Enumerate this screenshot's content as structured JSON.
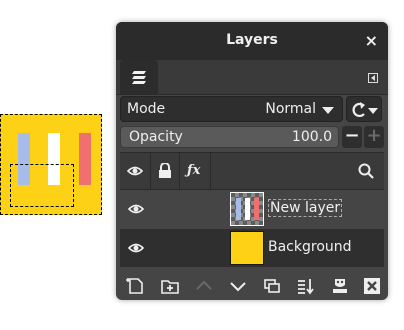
{
  "panel": {
    "title": "Layers",
    "close_glyph": "×"
  },
  "mode": {
    "label": "Mode",
    "value": "Normal"
  },
  "opacity": {
    "label": "Opacity",
    "value": "100.0",
    "decrease_glyph": "−",
    "increase_glyph": "+"
  },
  "layers": [
    {
      "name": "New layer",
      "selected": false,
      "visible": true
    },
    {
      "name": "Background",
      "selected": true,
      "visible": true
    }
  ],
  "icons": {
    "tab": "layers-tab-icon",
    "header_eye": "eye-icon",
    "header_lock": "lock-icon",
    "header_fx": "fx-icon",
    "header_search": "search-icon",
    "bottom": [
      "new-layer-icon",
      "new-group-icon",
      "raise-layer-icon",
      "lower-layer-icon",
      "duplicate-layer-icon",
      "merge-down-icon",
      "add-mask-icon",
      "delete-layer-icon"
    ]
  },
  "colors": {
    "canvas_yellow": "#fcd116",
    "stripe_blue": "#a8bcec",
    "stripe_white": "#ffffff",
    "stripe_red": "#f07070",
    "panel_bg": "#454545",
    "selected_row": "#2f2f2f"
  }
}
